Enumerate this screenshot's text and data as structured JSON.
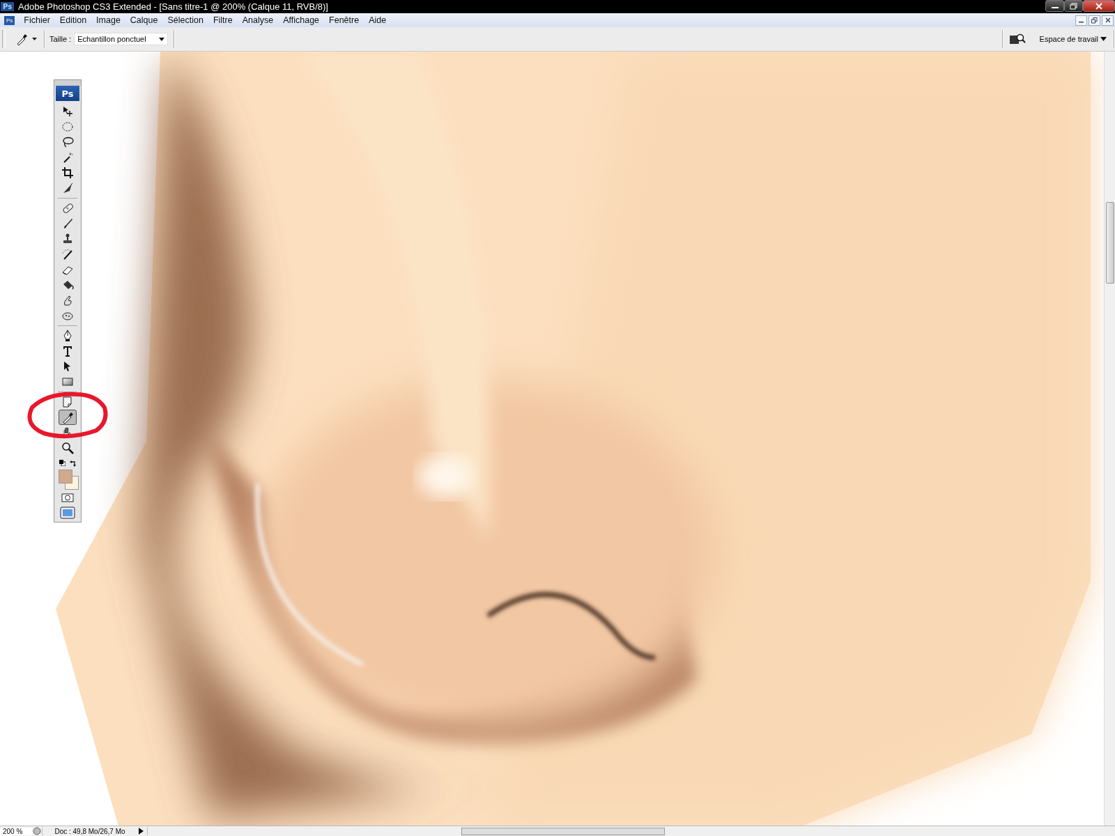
{
  "window": {
    "title": "Adobe Photoshop CS3 Extended - [Sans titre-1 @ 200% (Calque 11, RVB/8)]",
    "app_badge": "Ps"
  },
  "menu": {
    "badge": "Ps",
    "items": [
      "Fichier",
      "Edition",
      "Image",
      "Calque",
      "Sélection",
      "Filtre",
      "Analyse",
      "Affichage",
      "Fenêtre",
      "Aide"
    ]
  },
  "options_bar": {
    "size_label": "Taille :",
    "size_value": "Echantillon ponctuel",
    "workspace": "Espace de travail"
  },
  "toolbox": {
    "logo": "Ps",
    "tools": [
      {
        "kind": "move",
        "selected": false
      },
      {
        "kind": "marquee",
        "selected": false
      },
      {
        "kind": "lasso",
        "selected": false
      },
      {
        "kind": "wand",
        "selected": false
      },
      {
        "kind": "crop",
        "selected": false
      },
      {
        "kind": "slice",
        "selected": false
      },
      {
        "kind": "separator"
      },
      {
        "kind": "healing",
        "selected": false
      },
      {
        "kind": "brush",
        "selected": false
      },
      {
        "kind": "stamp",
        "selected": false
      },
      {
        "kind": "history",
        "selected": false
      },
      {
        "kind": "eraser",
        "selected": false
      },
      {
        "kind": "bucket",
        "selected": false
      },
      {
        "kind": "smudge",
        "selected": false
      },
      {
        "kind": "dodge",
        "selected": false
      },
      {
        "kind": "separator"
      },
      {
        "kind": "pen",
        "selected": false
      },
      {
        "kind": "type",
        "selected": false
      },
      {
        "kind": "pathselect",
        "selected": false
      },
      {
        "kind": "shape",
        "selected": false
      },
      {
        "kind": "separator"
      },
      {
        "kind": "notes",
        "selected": false
      },
      {
        "kind": "eyedropper",
        "selected": true
      },
      {
        "kind": "hand",
        "selected": false
      },
      {
        "kind": "zoom",
        "selected": false
      }
    ],
    "swatches": [
      {
        "kind": "background",
        "color": "#fdf4dc"
      },
      {
        "kind": "foreground",
        "color": "#d3a88b"
      }
    ]
  },
  "status_bar": {
    "zoom": "200 %",
    "doc": "Doc : 49,8 Mo/26,7 Mo"
  }
}
